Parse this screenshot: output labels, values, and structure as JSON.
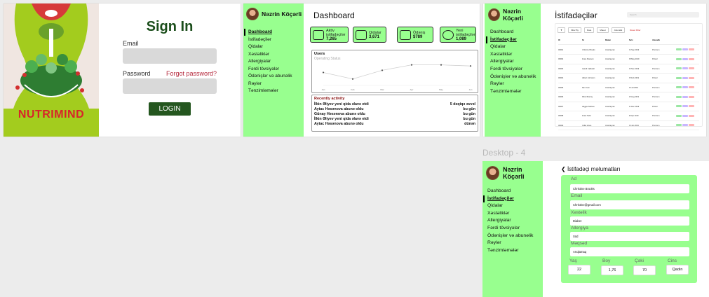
{
  "signin": {
    "brand": "NUTRIMIND",
    "title": "Sign In",
    "email_label": "Email",
    "password_label": "Password",
    "forgot_label": "Forgot password?",
    "login_label": "LOGIN"
  },
  "profile": {
    "name": "Nəzrin Köçərli"
  },
  "nav": {
    "items": [
      "Dashboard",
      "İstifadəçilər",
      "Qidalar",
      "Xəstəliklər",
      "Allergiyalar",
      "Fərdi tövsiyələr",
      "Ödənişlər və abunəlik",
      "Rəylər",
      "Tənzimləmələr"
    ]
  },
  "dashboard": {
    "title": "Dashboard",
    "stats": [
      {
        "label": "Aktiv istifadəçilər",
        "value": "7,265"
      },
      {
        "label": "Qidalar",
        "value": "3,671"
      },
      {
        "label": "Ödəniş",
        "value": "$789"
      },
      {
        "label": "Yeni istifadəçilər",
        "value": "1,089"
      }
    ],
    "chart_title": "Users",
    "chart_subtitle": "Operating Status",
    "activity_title": "Recently activity",
    "activities": [
      {
        "text": "İlkin Əliyev yeni qida əlavə etdi",
        "time": "5 dəqiqə əvvəl"
      },
      {
        "text": "Aytac Həsənova abunə oldu",
        "time": "bu gün"
      },
      {
        "text": "Günay Həsənova abunə oldu",
        "time": "bu gün"
      },
      {
        "text": "İlkin Əliyev yeni qida əlavə etdi",
        "time": "bu gün"
      },
      {
        "text": "Aytac Həsənova abunə oldu",
        "time": "dünən"
      }
    ]
  },
  "chart_data": {
    "type": "line",
    "title": "Users",
    "x": [
      "Jan",
      "Feb",
      "Mar",
      "Apr",
      "May",
      "Jun"
    ],
    "values": [
      12,
      6,
      14,
      19,
      19,
      18
    ]
  },
  "users": {
    "title": "İstifadəçilər",
    "search_placeholder": "Search",
    "filters": [
      "Filter By",
      "Date",
      "Mauet",
      "Abunalik",
      "Reset Filter"
    ],
    "columns": [
      "ID",
      "Ad",
      "Məkan",
      "Tarix",
      "Abunəlik",
      ""
    ],
    "rows": [
      [
        "00001",
        "Christine Brooks",
        "Azərbaycan",
        "04 Sep 2019",
        "Premium"
      ],
      [
        "00002",
        "Rosie Pearson",
        "Azərbaycan",
        "28 May 2019",
        "Pulsuz"
      ],
      [
        "00003",
        "Darrell Caldwell",
        "Azərbaycan",
        "23 Nov 2019",
        "Premium"
      ],
      [
        "00004",
        "Gilbert Johnston",
        "Azərbaycan",
        "05 Feb 2019",
        "Pulsuz"
      ],
      [
        "00005",
        "Alan Cain",
        "Azərbaycan",
        "29 Jul 2019",
        "Premium"
      ],
      [
        "00006",
        "Alfred Murray",
        "Azərbaycan",
        "15 Aug 2019",
        "Premium"
      ],
      [
        "00007",
        "Maggie Sullivan",
        "Azərbaycan",
        "21 Dec 2019",
        "Pulsuz"
      ],
      [
        "00008",
        "Rosie Todd",
        "Azərbaycan",
        "30 Apr 2019",
        "Premium"
      ],
      [
        "00009",
        "Dollie Hines",
        "Azərbaycan",
        "09 Jan 2019",
        "Premium"
      ]
    ]
  },
  "detail": {
    "frame_label": "Desktop - 4",
    "title": "İstifadəçi məlumatları",
    "fields": [
      {
        "label": "Ad",
        "value": "Christine Brooks"
      },
      {
        "label": "Email",
        "value": "Christine@gmail.com"
      },
      {
        "label": "Xəstəlik",
        "value": "Diabet"
      },
      {
        "label": "Allergiya",
        "value": "Süd"
      },
      {
        "label": "Məqsəd",
        "value": "Arıqlamaq"
      }
    ],
    "small_fields": [
      {
        "label": "Yaş",
        "value": "22"
      },
      {
        "label": "Boy",
        "value": "1,76"
      },
      {
        "label": "Çəki",
        "value": "70"
      },
      {
        "label": "Cins",
        "value": "Qadın"
      }
    ]
  },
  "colors": {
    "sidebar": "#98ff8f",
    "brand_green": "#24561f",
    "brand_red": "#d8232a",
    "hero": "#a3cc1e"
  }
}
